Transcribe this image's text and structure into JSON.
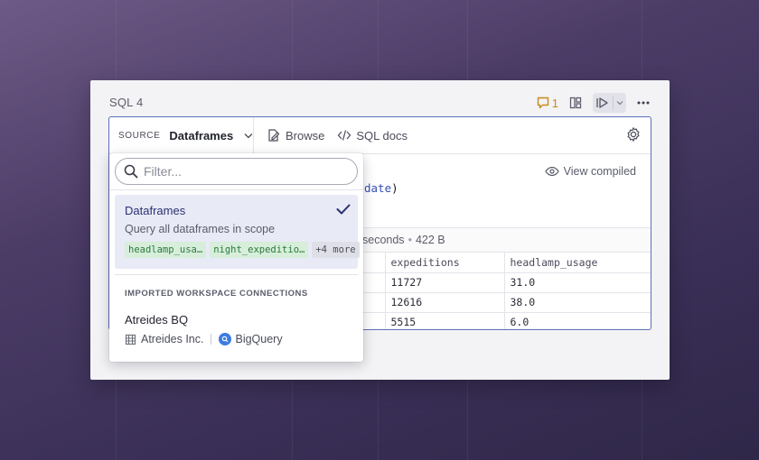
{
  "cell": {
    "title": "SQL 4",
    "comment_count": "1"
  },
  "toolbar": {
    "source_label": "SOURCE",
    "source_value": "Dataframes",
    "browse_label": "Browse",
    "docs_label": "SQL docs"
  },
  "code": {
    "keyword": "date",
    "suffix": ")"
  },
  "view_compiled_label": "View compiled",
  "result_meta": {
    "duration": "seconds",
    "size": "422 B"
  },
  "table": {
    "columns": [
      "expeditions",
      "headlamp_usage"
    ],
    "rows": [
      [
        "11727",
        "31.0"
      ],
      [
        "12616",
        "38.0"
      ],
      [
        "5515",
        "6.0"
      ]
    ]
  },
  "dropdown": {
    "filter_placeholder": "Filter...",
    "selected_option": {
      "title": "Dataframes",
      "description": "Query all dataframes in scope",
      "chips": [
        "headlamp_usa…",
        "night_expeditio…"
      ],
      "more": "+4 more"
    },
    "section_header": "IMPORTED WORKSPACE CONNECTIONS",
    "connection": {
      "name": "Atreides BQ",
      "workspace": "Atreides Inc.",
      "type": "BigQuery"
    }
  },
  "colors": {
    "accent": "#5b6fb8",
    "selected_bg": "#e8eaf6",
    "comment": "#c98a1a",
    "chip_green_bg": "#d7eedb",
    "chip_green_text": "#2b7a3c",
    "bigquery": "#3d7be0"
  },
  "icons": [
    "comment-icon",
    "layout-icon",
    "run-icon",
    "chevron-down-icon",
    "more-icon",
    "browse-icon",
    "code-icon",
    "gear-icon",
    "eye-icon",
    "search-icon",
    "check-icon",
    "building-icon",
    "bigquery-icon"
  ]
}
